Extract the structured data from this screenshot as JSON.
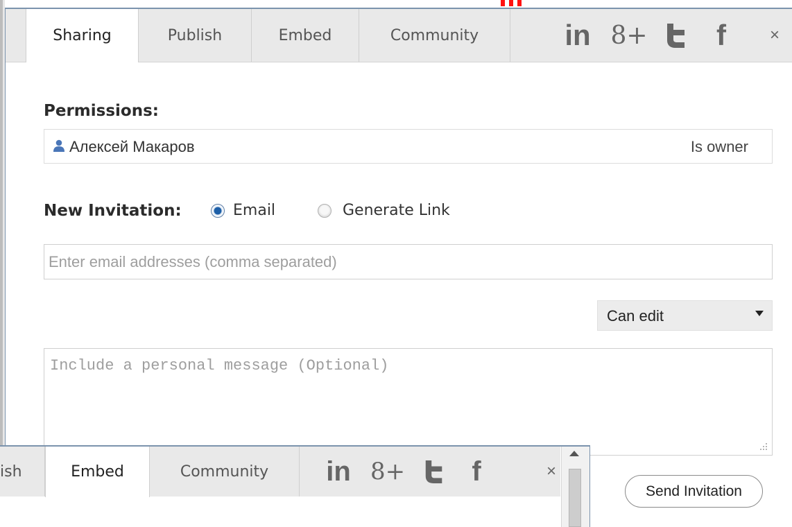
{
  "tabs": [
    {
      "label": "Sharing",
      "active": true
    },
    {
      "label": "Publish",
      "active": false
    },
    {
      "label": "Embed",
      "active": false
    },
    {
      "label": "Community",
      "active": false
    }
  ],
  "social": {
    "linkedin": "in",
    "googleplus": "8+",
    "twitter": "t",
    "facebook": "f",
    "close": "×"
  },
  "permissions": {
    "label": "Permissions:",
    "user_name": "Алексей Макаров",
    "role": "Is owner"
  },
  "invitation": {
    "label": "New Invitation:",
    "option_email": "Email",
    "option_link": "Generate Link",
    "selected": "Email",
    "email_placeholder": "Enter email addresses (comma separated)",
    "email_value": "",
    "permission_select": "Can edit",
    "message_placeholder": "Include a personal message (Optional)",
    "message_value": "",
    "send_label": "Send Invitation"
  },
  "overlay": {
    "tabs": [
      {
        "label": "ish",
        "active": false
      },
      {
        "label": "Embed",
        "active": true
      },
      {
        "label": "Community",
        "active": false
      }
    ],
    "social": {
      "linkedin": "in",
      "googleplus": "8+",
      "twitter": "t",
      "facebook": "f",
      "close": "×"
    }
  },
  "colors": {
    "accent_border": "#7b93ad",
    "tab_bar_bg": "#e9e9e9",
    "radio_selected": "#1d5fa8",
    "user_icon": "#4a76b8"
  }
}
